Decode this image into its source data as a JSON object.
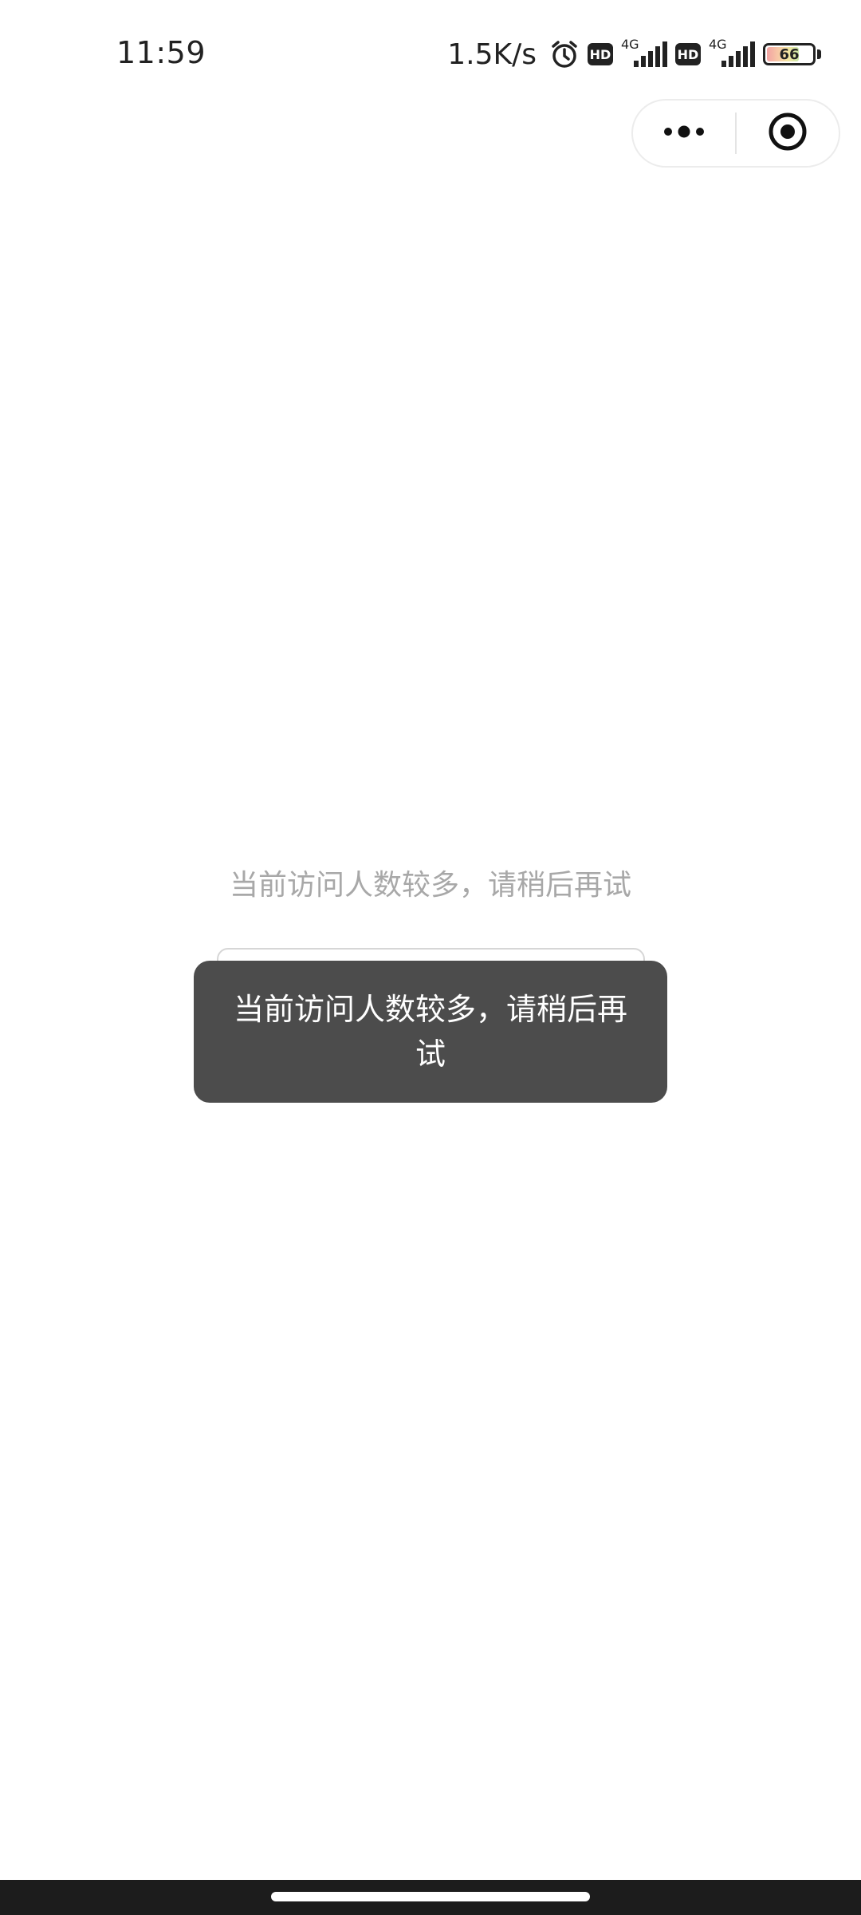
{
  "status_bar": {
    "time": "11:59",
    "net_speed": "1.5K/s",
    "hd_label": "HD",
    "network_type": "4G",
    "battery_level": "66",
    "icons": [
      "alarm-icon",
      "signal-icon",
      "battery-icon"
    ]
  },
  "capsule": {
    "icons": [
      "more-dots-icon",
      "close-target-icon"
    ]
  },
  "main": {
    "message": "当前访问人数较多，请稍后再试"
  },
  "toast": {
    "message": "当前访问人数较多，请稍后再试"
  },
  "colors": {
    "toast_bg": "#4c4c4c",
    "message_text": "#a8a8a8",
    "nav_bar": "#1c1c1c"
  }
}
